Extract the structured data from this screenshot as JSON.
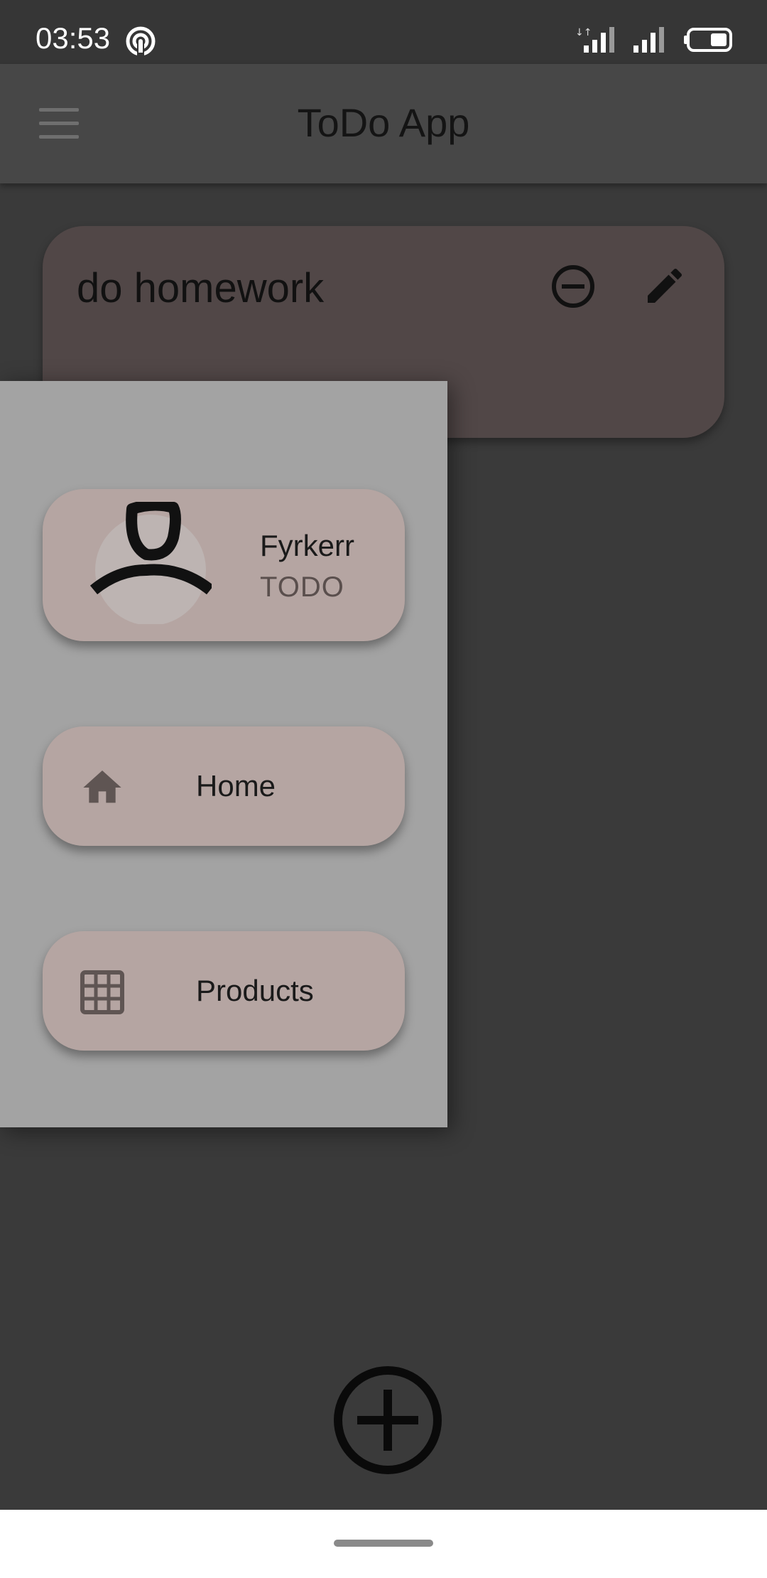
{
  "status_bar": {
    "time": "03:53",
    "icons": [
      "hotspot-icon",
      "signal-icon",
      "signal-icon",
      "battery-icon"
    ]
  },
  "app_bar": {
    "title": "ToDo App",
    "menu_icon": "menu-icon"
  },
  "todos": [
    {
      "title": "do homework",
      "actions": [
        "remove-icon",
        "edit-icon"
      ]
    }
  ],
  "drawer": {
    "profile": {
      "name": "Fyrkerr",
      "subtitle": "TODO",
      "avatar_icon": "person-icon"
    },
    "items": [
      {
        "label": "Home",
        "icon": "home-icon"
      },
      {
        "label": "Products",
        "icon": "grid-icon"
      }
    ]
  },
  "fab": {
    "icon": "add-circle-icon"
  },
  "colors": {
    "background": "#3a3a3a",
    "app_bar": "#474747",
    "card": "#514747",
    "drawer": "#a3a3a3",
    "drawer_card": "#b5a5a2"
  }
}
